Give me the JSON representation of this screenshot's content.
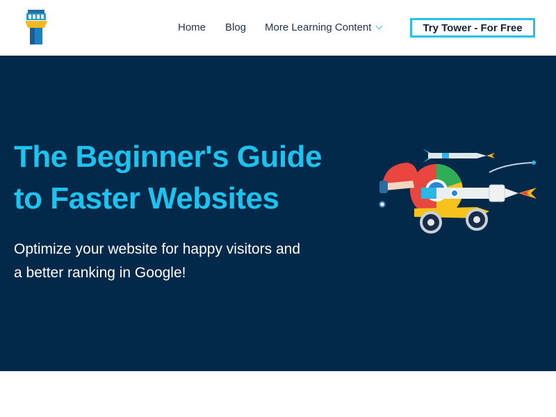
{
  "header": {
    "logo_icon": "tower-logo-icon",
    "nav": {
      "home": "Home",
      "blog": "Blog",
      "more": "More Learning Content",
      "more_icon": "chevron-down-icon"
    },
    "cta_label": "Try Tower - For Free"
  },
  "hero": {
    "title_line1": "The Beginner's Guide",
    "title_line2": "to Faster Websites",
    "subtitle_line1": "Optimize your website for happy visitors and",
    "subtitle_line2": "a better ranking in Google!",
    "illustration_icon": "rocket-browser-illustration"
  },
  "colors": {
    "hero_bg": "#03294a",
    "accent": "#1cc3ef",
    "cta_border": "#23bfe8"
  }
}
